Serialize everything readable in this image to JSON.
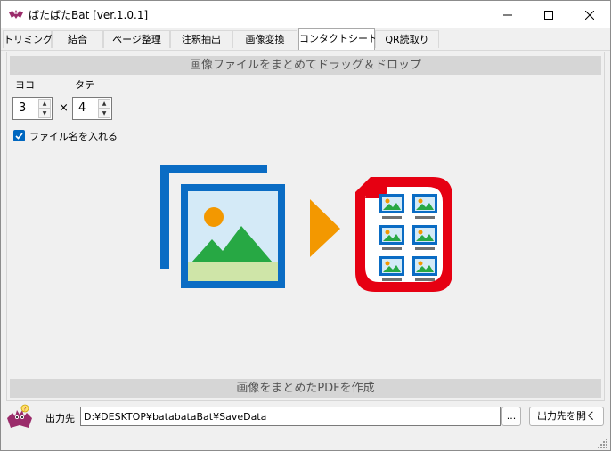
{
  "window": {
    "title": "ばたばたBat [ver.1.0.1]",
    "app_icon": "bat-icon",
    "controls": [
      "minimize-icon",
      "maximize-icon",
      "close-icon"
    ]
  },
  "tabs": [
    {
      "label": "トリミング"
    },
    {
      "label": "結合"
    },
    {
      "label": "ページ整理"
    },
    {
      "label": "注釈抽出"
    },
    {
      "label": "画像変換"
    },
    {
      "label": "コンタクトシート",
      "selected": true
    },
    {
      "label": "QR読取り"
    }
  ],
  "panel": {
    "drop_banner": "画像ファイルをまとめてドラッグ＆ドロップ",
    "yoko": {
      "label": "ヨコ",
      "value": "3"
    },
    "tate": {
      "label": "タテ",
      "value": "4"
    },
    "times_sign": "×",
    "filename_checkbox": {
      "label": "ファイル名を入れる",
      "checked": true
    },
    "illustration_icons": [
      "image-stack-icon",
      "arrow-right-icon",
      "contact-sheet-pdf-icon"
    ],
    "create_pdf_label": "画像をまとめたPDFを作成"
  },
  "footer": {
    "mascot_icon": "bat-mascot-icon",
    "output_label": "出力先",
    "output_path": "D:¥DESKTOP¥batabataBat¥SaveData",
    "browse_label": "...",
    "open_button_label": "出力先を開く"
  },
  "colors": {
    "accent_blue": "#0067c0",
    "image_frame_blue": "#0a6cc4",
    "arrow_orange": "#f39800",
    "pdf_red": "#e60012",
    "banner_gray": "#d6d6d6",
    "mountain_green": "#27a844",
    "sun_orange": "#f39800"
  }
}
